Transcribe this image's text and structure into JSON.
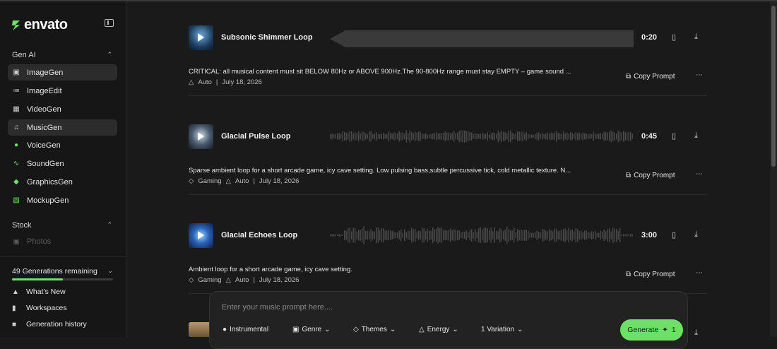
{
  "brand": {
    "name": "envato",
    "color": "#6fe067"
  },
  "sidebar": {
    "gen_ai_heading": "Gen AI",
    "items": [
      {
        "label": "ImageGen",
        "icon": "image-icon"
      },
      {
        "label": "ImageEdit",
        "icon": "edit-icon"
      },
      {
        "label": "VideoGen",
        "icon": "video-icon"
      },
      {
        "label": "MusicGen",
        "icon": "music-icon"
      },
      {
        "label": "VoiceGen",
        "icon": "mic-icon"
      },
      {
        "label": "SoundGen",
        "icon": "sound-wave-icon"
      },
      {
        "label": "GraphicsGen",
        "icon": "graphics-icon"
      },
      {
        "label": "MockupGen",
        "icon": "shirt-icon"
      }
    ],
    "stock_heading": "Stock",
    "stock_items": [
      {
        "label": "Photos",
        "icon": "photo-icon"
      }
    ],
    "generations_remaining": "49 Generations remaining",
    "generations_fraction": 0.5,
    "bottom_items": [
      {
        "label": "What's New",
        "icon": "flame-icon"
      },
      {
        "label": "Workspaces",
        "icon": "bookmark-icon"
      },
      {
        "label": "Generation history",
        "icon": "history-icon"
      }
    ]
  },
  "tracks": [
    {
      "title": "Subsonic Shimmer Loop",
      "duration": "0:20",
      "prompt": "CRITICAL: all musical content must sit BELOW 80Hz or ABOVE 900Hz.The 90-800Hz range must stay EMPTY – game sound ...",
      "tags": [],
      "mode": "Auto",
      "date": "July 18, 2026",
      "copy_label": "Copy Prompt"
    },
    {
      "title": "Glacial Pulse Loop",
      "duration": "0:45",
      "prompt": "Sparse ambient loop for a short arcade game, icy cave setting. Low pulsing bass,subtle percussive tick, cold metallic texture. N...",
      "tags": [
        "Gaming"
      ],
      "mode": "Auto",
      "date": "July 18, 2026",
      "copy_label": "Copy Prompt"
    },
    {
      "title": "Glacial Echoes Loop",
      "duration": "3:00",
      "prompt": "Ambient loop for a short arcade game, icy cave setting.",
      "tags": [
        "Gaming"
      ],
      "mode": "Auto",
      "date": "July 18, 2026",
      "copy_label": "Copy Prompt"
    }
  ],
  "composer": {
    "placeholder": "Enter your music prompt here....",
    "chips": [
      "Instrumental",
      "Genre",
      "Themes",
      "Energy",
      "1 Variation"
    ],
    "generate_label": "Generate",
    "generate_cost": "1"
  }
}
